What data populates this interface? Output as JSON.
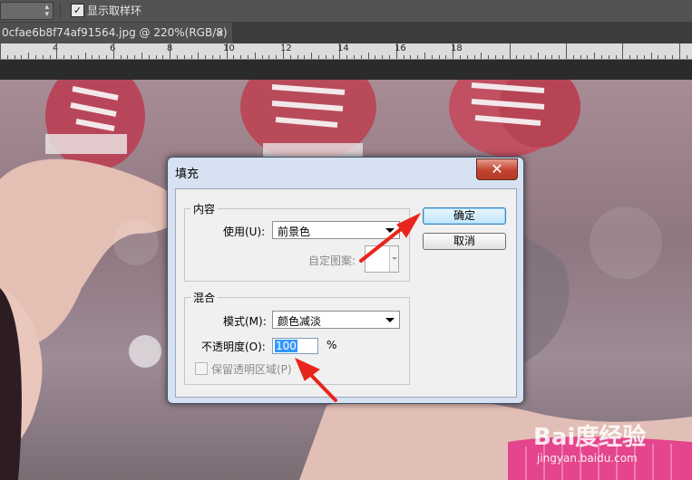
{
  "optionbar": {
    "show_sampling_ring_label": "显示取样环",
    "show_sampling_ring_checked": true
  },
  "document_tab": {
    "title": "0cfae6b8f74af91564.jpg @ 220%(RGB/8) *",
    "close": "×"
  },
  "ruler": {
    "labels": [
      "4",
      "6",
      "8",
      "10",
      "12",
      "14",
      "16",
      "18"
    ]
  },
  "dialog": {
    "title": "填充",
    "close_glyph": "✕",
    "content_group": {
      "legend": "内容",
      "use_label": "使用(U):",
      "use_value": "前景色",
      "custom_pattern_label": "自定图案:"
    },
    "blend_group": {
      "legend": "混合",
      "mode_label": "模式(M):",
      "mode_value": "颜色减淡",
      "opacity_label": "不透明度(O):",
      "opacity_value": "100",
      "opacity_unit": "%",
      "preserve_label": "保留透明区域(P)",
      "preserve_checked": false
    },
    "ok_label": "确定",
    "cancel_label": "取消"
  },
  "watermark": {
    "brand": "Bai度经验",
    "url": "jingyan.baidu.com"
  },
  "colors": {
    "annotation_arrow": "#e8251c",
    "dialog_frame": "#d6e2f1",
    "close_button": "#c2442f"
  }
}
